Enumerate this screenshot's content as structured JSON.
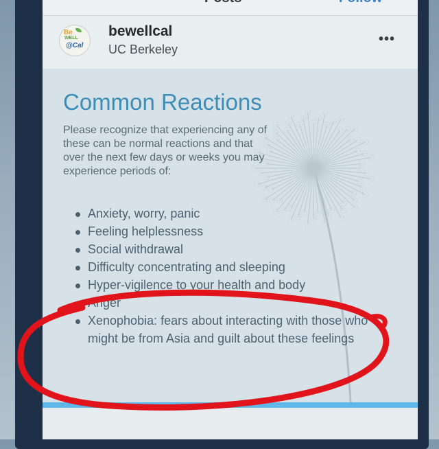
{
  "topbar": {
    "title": "Posts",
    "action": "Follow"
  },
  "profile": {
    "avatar_line1": "Be",
    "avatar_line2": "WELL",
    "avatar_line3": "@Cal",
    "username": "bewellcal",
    "subtitle": "UC Berkeley",
    "more": "•••"
  },
  "post": {
    "title": "Common Reactions",
    "intro": "Please recognize that experiencing any of these can be normal reactions and that over the next few days or weeks you may experience periods of:",
    "bullets": [
      "Anxiety, worry, panic",
      "Feeling helplessness",
      "Social withdrawal",
      "Difficulty concentrating and sleeping",
      "Hyper-vigilence to your health and body",
      "Anger",
      "Xenophobia: fears about interacting with those who might be from Asia and guilt about these feelings"
    ]
  },
  "colors": {
    "frame": "#1e3048",
    "title_blue": "#3d8db6",
    "annotation_red": "#e0141a",
    "accent_strip": "#5fb8e8"
  },
  "icons": [
    "more-options-icon",
    "dandelion-illustration"
  ]
}
